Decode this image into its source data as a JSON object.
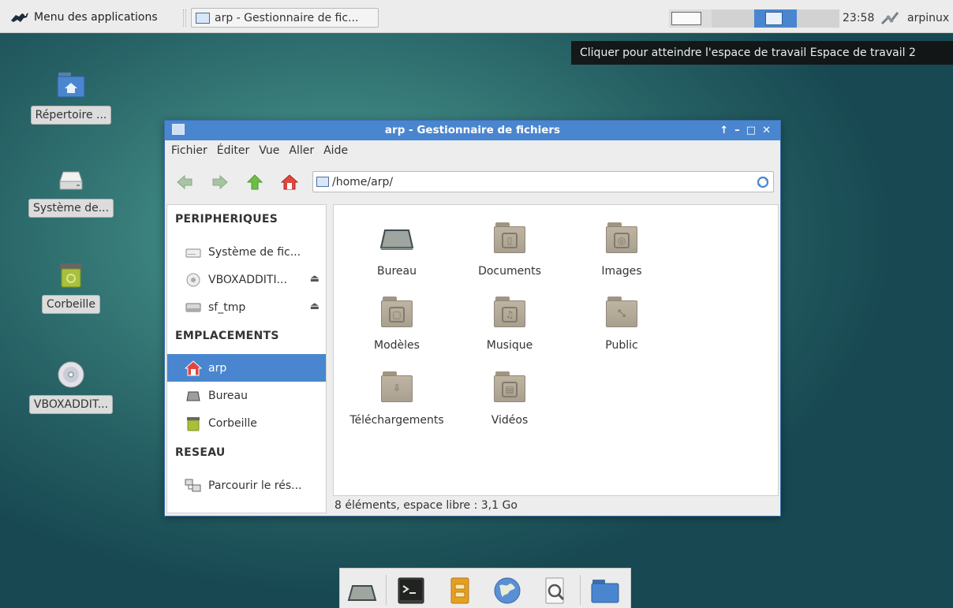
{
  "top_panel": {
    "app_menu_label": "Menu des applications",
    "task_label": "arp - Gestionnaire de fic...",
    "clock": "23:58",
    "user": "arpinux"
  },
  "tooltip": "Cliquer pour atteindre l'espace de travail Espace de travail 2",
  "desktop_icons": [
    {
      "label": "Répertoire ...",
      "icon": "home-folder-icon"
    },
    {
      "label": "Système de...",
      "icon": "drive-icon"
    },
    {
      "label": "Corbeille",
      "icon": "trash-icon"
    },
    {
      "label": "VBOXADDIT...",
      "icon": "cdrom-icon"
    }
  ],
  "window": {
    "title": "arp - Gestionnaire de fichiers",
    "menu": [
      "Fichier",
      "Éditer",
      "Vue",
      "Aller",
      "Aide"
    ],
    "path": "/home/arp/",
    "sidebar": {
      "sections": [
        "PERIPHERIQUES",
        "EMPLACEMENTS",
        "RESEAU"
      ],
      "devices": [
        "Système de fic...",
        "VBOXADDITI...",
        "sf_tmp"
      ],
      "places": [
        "arp",
        "Bureau",
        "Corbeille"
      ],
      "network": [
        "Parcourir le rés..."
      ]
    },
    "files": [
      "Bureau",
      "Documents",
      "Images",
      "Modèles",
      "Musique",
      "Public",
      "Téléchargements",
      "Vidéos"
    ],
    "status": "8 éléments, espace libre : 3,1 Go"
  },
  "colors": {
    "accent": "#4a86cf",
    "panel": "#ececec",
    "folder": "#b3a995"
  },
  "dock": [
    "desktop-icon",
    "terminal-icon",
    "archive-icon",
    "web-browser-icon",
    "search-icon",
    "folder-icon"
  ]
}
